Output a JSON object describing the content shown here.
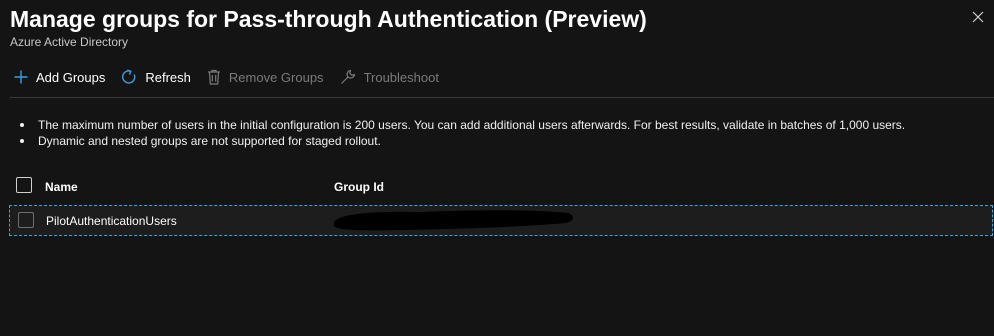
{
  "header": {
    "title": "Manage groups for Pass-through Authentication (Preview)",
    "subtitle": "Azure Active Directory",
    "close_icon": "close-icon"
  },
  "toolbar": {
    "add_label": "Add Groups",
    "refresh_label": "Refresh",
    "remove_label": "Remove Groups",
    "troubleshoot_label": "Troubleshoot",
    "accent_color": "#3c9ee0",
    "disabled_color": "#7a7a7a"
  },
  "notes": [
    "The maximum number of users in the initial configuration is 200 users. You can add additional users afterwards. For best results, validate in batches of 1,000 users.",
    "Dynamic and nested groups are not supported for staged rollout."
  ],
  "table": {
    "columns": [
      "Name",
      "Group Id"
    ],
    "rows": [
      {
        "name": "PilotAuthenticationUsers"
      }
    ]
  },
  "colors": {
    "background": "#141414",
    "selection_border": "#36a7d6"
  }
}
